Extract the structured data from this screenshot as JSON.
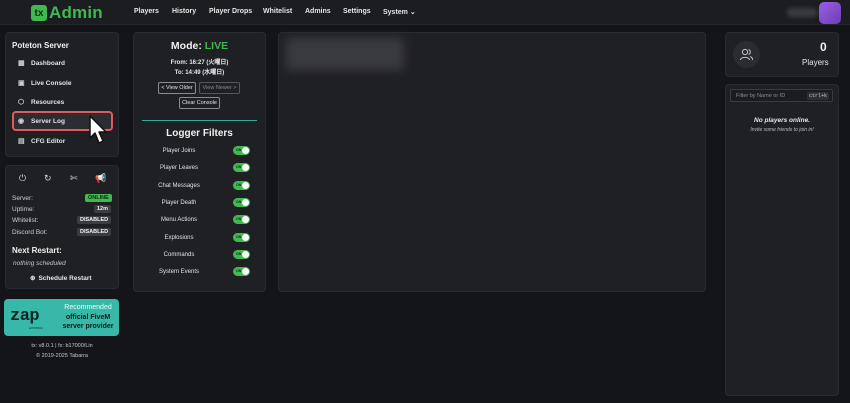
{
  "colors": {
    "accent": "#3fb950",
    "highlight": "#e05a60",
    "zap": "#37b8a8"
  },
  "brand": {
    "logo_mark": "tx",
    "name": "Admin"
  },
  "nav": [
    "Players",
    "History",
    "Player Drops",
    "Whitelist",
    "Admins",
    "Settings",
    "System ⌄"
  ],
  "sidebar": {
    "server_name": "Poteton Server",
    "items": [
      {
        "label": "Dashboard",
        "icon": "dashboard-icon"
      },
      {
        "label": "Live Console",
        "icon": "terminal-icon"
      },
      {
        "label": "Resources",
        "icon": "puzzle-icon"
      },
      {
        "label": "Server Log",
        "icon": "eye-icon",
        "active": true
      },
      {
        "label": "CFG Editor",
        "icon": "file-icon"
      }
    ]
  },
  "status": {
    "server_label": "Server:",
    "server_value": "ONLINE",
    "uptime_label": "Uptime:",
    "uptime_value": "12m",
    "whitelist_label": "Whitelist:",
    "whitelist_value": "DISABLED",
    "discord_label": "Discord Bot:",
    "discord_value": "DISABLED",
    "next_restart_title": "Next Restart:",
    "next_restart_value": "nothing scheduled",
    "schedule_button": "Schedule Restart"
  },
  "zap": {
    "logo": "zap",
    "logo_sub": "HOSTING",
    "line1": "Recommended",
    "line2": "official FiveM",
    "line3": "server provider"
  },
  "footer": {
    "version": "tx: v8.0.1 | fx: b17000/Lin",
    "copyright": "© 2019-2025 Tabarra"
  },
  "log": {
    "mode_label": "Mode:",
    "mode_value": "LIVE",
    "from": "From: 16:27 (火曜日)",
    "to": "To: 14:49 (水曜日)",
    "view_older": "< View Older",
    "view_newer": "View Newer >",
    "clear_console": "Clear Console",
    "filters_title": "Logger Filters",
    "filters": [
      "Player Joins",
      "Player Leaves",
      "Chat Messages",
      "Player Death",
      "Menu Actions",
      "Explosions",
      "Commands",
      "System Events"
    ],
    "toggle_on": "ON"
  },
  "players": {
    "count": "0",
    "label": "Players",
    "filter_placeholder": "Filter by Name or ID",
    "filter_shortcut": "ctrl+k",
    "empty_title": "No players online.",
    "empty_sub": "Invite some friends to join in!"
  }
}
